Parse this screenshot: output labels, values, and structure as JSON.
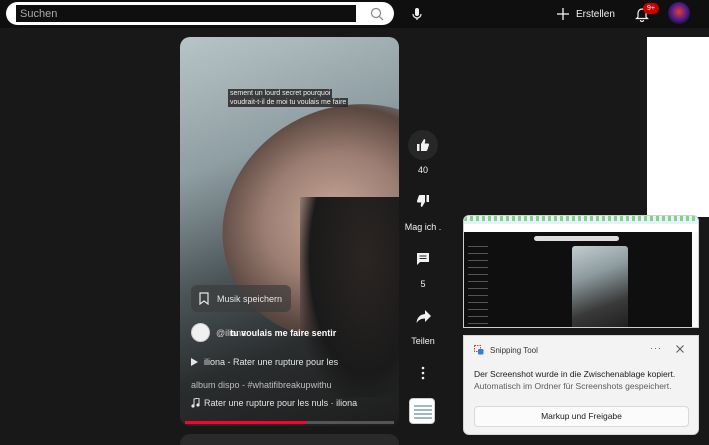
{
  "topbar": {
    "search_placeholder": "Suchen",
    "create_label": "Erstellen",
    "notification_count": "9+"
  },
  "video": {
    "caption_line1": "sement un lourd secret pourquoi",
    "caption_line2": "voudrait-t-il de moi tu voulais me faire",
    "save_music_label": "Musik speichern",
    "channel_name": "@iliona",
    "title": "tu voulais me faire sentir",
    "description_line1": "iliona - Rater une rupture pour les",
    "description_line2": "album dispo - #whatifibreakupwithu",
    "music": "Rater une rupture pour les nuls · iliona",
    "progress_percent": 58
  },
  "actions": {
    "like_count": "40",
    "dislike_label": "Mag ich .",
    "comment_count": "5",
    "share_label": "Teilen"
  },
  "toast": {
    "app_name": "Snipping Tool",
    "more": "···",
    "line1": "Der Screenshot wurde in die Zwischenablage kopiert.",
    "line2": "Automatisch im Ordner für Screenshots gespeichert.",
    "button": "Markup und Freigabe"
  },
  "colors": {
    "background": "#181818",
    "accent_red": "#ff0033",
    "badge_red": "#cc0000"
  },
  "icons": [
    "search-icon",
    "microphone-icon",
    "plus-icon",
    "bell-icon",
    "like-icon",
    "dislike-icon",
    "comment-icon",
    "share-icon",
    "more-vertical-icon",
    "bookmark-icon",
    "play-icon",
    "music-note-icon",
    "snipping-tool-icon",
    "close-icon"
  ]
}
